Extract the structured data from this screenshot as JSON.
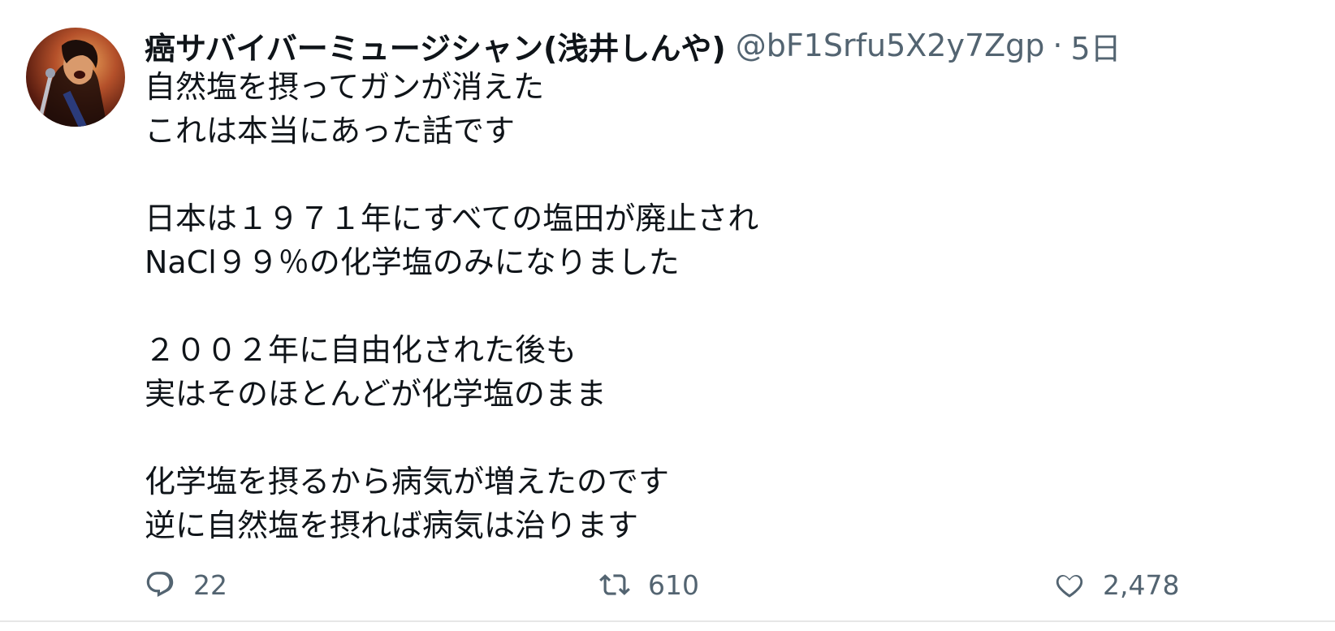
{
  "tweet": {
    "display_name": "癌サバイバーミュージシャン(浅井しんや)",
    "handle": "@bF1Srfu5X2y7Zgp",
    "separator": "·",
    "timestamp": "5日",
    "lines": [
      "自然塩を摂ってガンが消えた",
      "これは本当にあった話です",
      "",
      "日本は１９７１年にすべての塩田が廃止され",
      "NaCl９９％の化学塩のみになりました",
      "",
      "２００２年に自由化された後も",
      "実はそのほとんどが化学塩のまま",
      "",
      "化学塩を摂るから病気が増えたのです",
      "逆に自然塩を摂れば病気は治ります"
    ],
    "actions": {
      "reply": {
        "icon": "reply-icon",
        "count": "22"
      },
      "retweet": {
        "icon": "retweet-icon",
        "count": "610"
      },
      "like": {
        "icon": "heart-icon",
        "count": "2,478"
      }
    }
  },
  "colors": {
    "text_primary": "#0f1419",
    "text_secondary": "#536471",
    "divider": "#e6e6e6"
  }
}
